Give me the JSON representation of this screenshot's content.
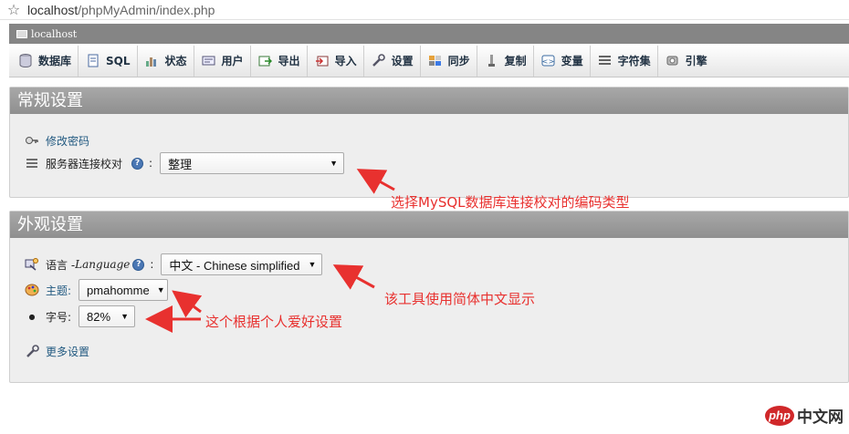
{
  "browser": {
    "url_host": "localhost",
    "url_path": "/phpMyAdmin/index.php"
  },
  "server": {
    "name": "localhost"
  },
  "tabs": [
    {
      "label": "数据库",
      "icon": "database-icon"
    },
    {
      "label": "SQL",
      "icon": "sql-icon"
    },
    {
      "label": "状态",
      "icon": "status-chart-icon"
    },
    {
      "label": "用户",
      "icon": "users-icon"
    },
    {
      "label": "导出",
      "icon": "export-icon"
    },
    {
      "label": "导入",
      "icon": "import-icon"
    },
    {
      "label": "设置",
      "icon": "wrench-icon"
    },
    {
      "label": "同步",
      "icon": "sync-icon"
    },
    {
      "label": "复制",
      "icon": "replication-icon"
    },
    {
      "label": "变量",
      "icon": "variables-icon"
    },
    {
      "label": "字符集",
      "icon": "charset-icon"
    },
    {
      "label": "引擎",
      "icon": "engine-icon"
    }
  ],
  "general": {
    "title": "常规设置",
    "change_password": "修改密码",
    "collation_label": "服务器连接校对",
    "collation_value": "整理"
  },
  "appearance": {
    "title": "外观设置",
    "language_label": "语言 - ",
    "language_label_en": "Language",
    "language_value": "中文 - Chinese simplified",
    "theme_label": "主题:",
    "theme_value": "pmahomme",
    "fontsize_label": "字号:",
    "fontsize_value": "82%",
    "more_settings": "更多设置"
  },
  "annotations": {
    "collation_note": "选择MySQL数据库连接校对的编码类型",
    "language_note": "该工具使用简体中文显示",
    "theme_note": "这个根据个人爱好设置"
  },
  "watermark": {
    "logo": "php",
    "text": "中文网"
  },
  "colors": {
    "annotation": "#e8312f",
    "legend_bg": "#999999",
    "link": "#235a81"
  }
}
